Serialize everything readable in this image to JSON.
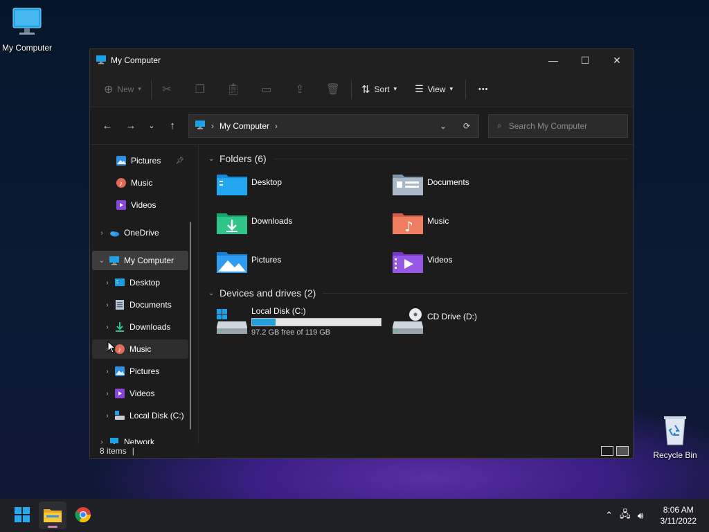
{
  "desktop": {
    "icons": [
      {
        "label": "My Computer",
        "icon": "monitor-icon"
      },
      {
        "label": "Recycle Bin",
        "icon": "recycle-bin-icon"
      }
    ]
  },
  "window": {
    "title": "My Computer",
    "controls": {
      "minimize": "—",
      "maximize": "☐",
      "close": "✕"
    },
    "toolbar": {
      "new_label": "New",
      "sort_label": "Sort",
      "view_label": "View",
      "more_label": "•••",
      "icons": [
        "cut-icon",
        "copy-icon",
        "paste-icon",
        "rename-icon",
        "share-icon",
        "delete-icon"
      ]
    },
    "address": {
      "path": "My Computer",
      "search_placeholder": "Search My Computer"
    },
    "sidebar": {
      "items": [
        {
          "label": "Pictures",
          "icon": "pictures-icon",
          "pinned": true
        },
        {
          "label": "Music",
          "icon": "music-icon"
        },
        {
          "label": "Videos",
          "icon": "videos-icon"
        },
        {
          "label": "OneDrive",
          "icon": "onedrive-icon"
        },
        {
          "label": "My Computer",
          "icon": "monitor-icon"
        },
        {
          "label": "Desktop",
          "icon": "desktop-folder-icon"
        },
        {
          "label": "Documents",
          "icon": "documents-icon"
        },
        {
          "label": "Downloads",
          "icon": "downloads-icon"
        },
        {
          "label": "Music",
          "icon": "music-icon"
        },
        {
          "label": "Pictures",
          "icon": "pictures-icon"
        },
        {
          "label": "Videos",
          "icon": "videos-icon"
        },
        {
          "label": "Local Disk (C:)",
          "icon": "local-disk-icon"
        },
        {
          "label": "Network",
          "icon": "network-icon"
        }
      ]
    },
    "content": {
      "folders_header": "Folders (6)",
      "folders": [
        {
          "label": "Desktop",
          "icon": "desktop-folder-icon"
        },
        {
          "label": "Documents",
          "icon": "documents-folder-icon"
        },
        {
          "label": "Downloads",
          "icon": "downloads-folder-icon"
        },
        {
          "label": "Music",
          "icon": "music-folder-icon"
        },
        {
          "label": "Pictures",
          "icon": "pictures-folder-icon"
        },
        {
          "label": "Videos",
          "icon": "videos-folder-icon"
        }
      ],
      "drives_header": "Devices and drives (2)",
      "drives": [
        {
          "label": "Local Disk (C:)",
          "free_text": "97.2 GB free of 119 GB",
          "used_fraction": 0.183
        },
        {
          "label": "CD Drive (D:)"
        }
      ]
    },
    "status": {
      "items": "8 items",
      "cursor": "|"
    }
  },
  "taskbar": {
    "apps": [
      "start-icon",
      "file-explorer-icon",
      "chrome-icon"
    ],
    "time": "8:06 AM",
    "date": "3/11/2022"
  },
  "colors": {
    "accent": "#26a0da",
    "window_bg": "#1c1c1c",
    "taskbar": "#1f1f26"
  }
}
